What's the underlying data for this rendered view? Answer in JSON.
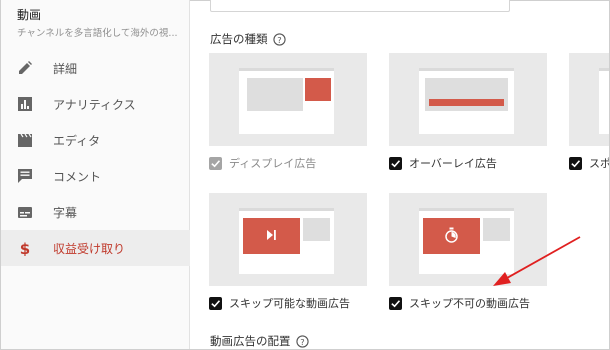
{
  "sidebar": {
    "title": "動画",
    "subtitle": "チャンネルを多言語化して海外の視...",
    "items": [
      {
        "label": "詳細",
        "icon": "pencil-icon",
        "active": false
      },
      {
        "label": "アナリティクス",
        "icon": "bar-chart-icon",
        "active": false
      },
      {
        "label": "エディタ",
        "icon": "clapperboard-icon",
        "active": false
      },
      {
        "label": "コメント",
        "icon": "comment-icon",
        "active": false
      },
      {
        "label": "字幕",
        "icon": "subtitles-icon",
        "active": false
      },
      {
        "label": "収益受け取り",
        "icon": "dollar-icon",
        "active": true
      }
    ]
  },
  "main": {
    "ad_types_heading": "広告の種類",
    "ad_placement_heading": "動画広告の配置",
    "ad_formats": [
      {
        "label": "ディスプレイ広告",
        "checked": true,
        "disabled": true
      },
      {
        "label": "オーバーレイ広告",
        "checked": true,
        "disabled": false
      },
      {
        "label": "スポ",
        "checked": true,
        "disabled": false
      },
      {
        "label": "スキップ可能な動画広告",
        "checked": true,
        "disabled": false
      },
      {
        "label": "スキップ不可の動画広告",
        "checked": true,
        "disabled": false
      }
    ]
  },
  "colors": {
    "accent": "#c0392b",
    "ad_red": "#d35a4a",
    "arrow": "#e02020",
    "card_bg": "#e9e9e9"
  }
}
